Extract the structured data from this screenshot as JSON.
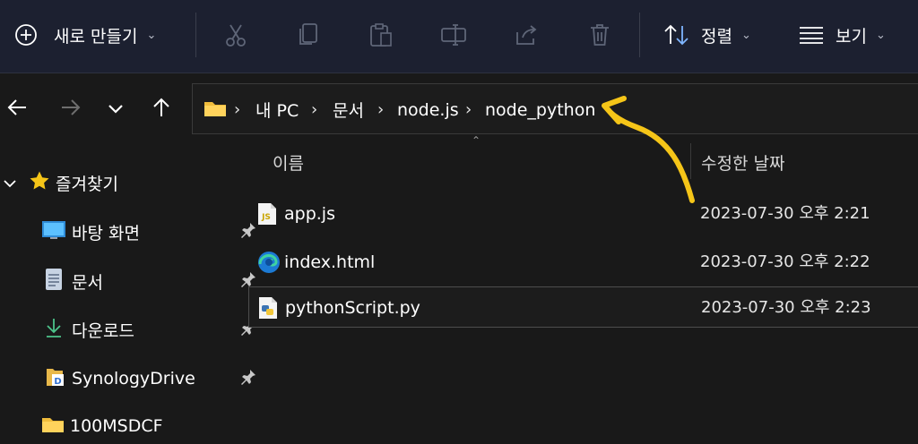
{
  "toolbar": {
    "new_label": "새로 만들기",
    "sort_label": "정렬",
    "view_label": "보기",
    "icons": [
      "plus-circle-icon",
      "cut-icon",
      "copy-icon",
      "paste-icon",
      "rename-icon",
      "share-icon",
      "delete-icon",
      "sort-icon",
      "view-icon"
    ]
  },
  "breadcrumb": {
    "items": [
      "내 PC",
      "문서",
      "node.js",
      "node_python"
    ],
    "separator": "›"
  },
  "sidebar": {
    "quick_access": "즐겨찾기",
    "items": [
      {
        "label": "바탕 화면",
        "icon": "desktop-icon",
        "pinned": true
      },
      {
        "label": "문서",
        "icon": "document-icon",
        "pinned": true
      },
      {
        "label": "다운로드",
        "icon": "download-icon",
        "pinned": true
      },
      {
        "label": "SynologyDrive",
        "icon": "synology-folder-icon",
        "pinned": true
      },
      {
        "label": "100MSDCF",
        "icon": "folder-icon",
        "pinned": false
      }
    ]
  },
  "columns": {
    "name": "이름",
    "modified": "수정한 날짜"
  },
  "files": [
    {
      "name": "app.js",
      "date": "2023-07-30 오후 2:21",
      "icon": "js-file-icon"
    },
    {
      "name": "index.html",
      "date": "2023-07-30 오후 2:22",
      "icon": "edge-html-icon"
    },
    {
      "name": "pythonScript.py",
      "date": "2023-07-30 오후 2:23",
      "icon": "python-file-icon",
      "selected": true
    }
  ],
  "colors": {
    "accent": "#f5c518",
    "toolbar_bg": "#1c2030",
    "background": "#191919"
  }
}
